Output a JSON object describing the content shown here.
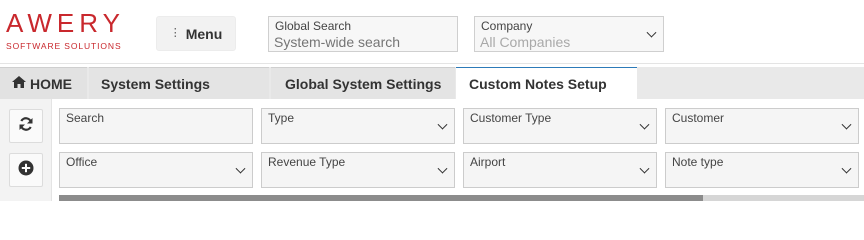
{
  "logo": {
    "word": "AWERY",
    "tagline": "SOFTWARE SOLUTIONS",
    "color": "#c9282d"
  },
  "header": {
    "menu_label": "Menu",
    "menu_icon": "vertical-dots-icon",
    "global_search": {
      "label": "Global Search",
      "placeholder": "System-wide search"
    },
    "company": {
      "label": "Company",
      "value": "All Companies"
    }
  },
  "tabs": {
    "home": "HOME",
    "home_icon": "house-icon",
    "items": [
      {
        "label": "System Settings"
      },
      {
        "label": "Global System Settings"
      },
      {
        "label": "Custom Notes Setup",
        "active": true
      }
    ]
  },
  "toolbar": {
    "refresh_icon": "refresh-icon",
    "add_icon": "add-circle-icon"
  },
  "filters": {
    "search": {
      "label": "Search"
    },
    "type": {
      "label": "Type"
    },
    "customer_type": {
      "label": "Customer Type"
    },
    "customer": {
      "label": "Customer"
    },
    "office": {
      "label": "Office"
    },
    "revenue_type": {
      "label": "Revenue Type"
    },
    "airport": {
      "label": "Airport"
    },
    "note_type": {
      "label": "Note type"
    }
  },
  "loading_progress": 0.8,
  "colors": {
    "accent_tab_border": "#2c7ab8",
    "progress_fill": "#8c8c8c"
  }
}
